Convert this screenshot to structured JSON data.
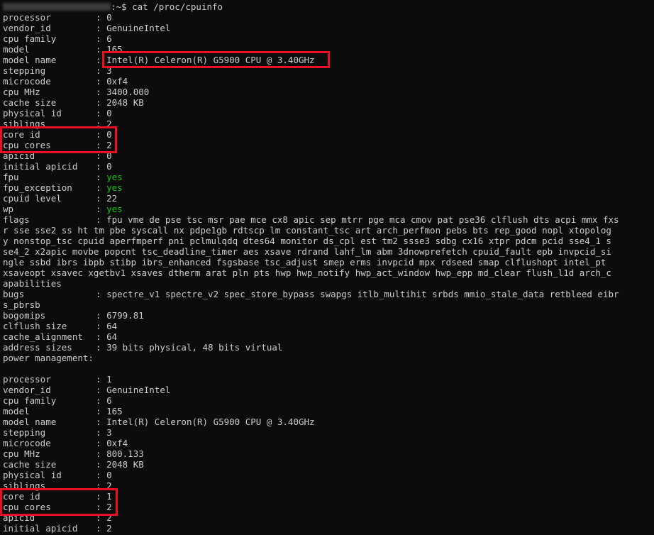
{
  "prompt": {
    "symbol": ":~$ ",
    "command": "cat /proc/cpuinfo"
  },
  "processor0": [
    {
      "key": "processor",
      "value": "0"
    },
    {
      "key": "vendor_id",
      "value": "GenuineIntel"
    },
    {
      "key": "cpu family",
      "value": "6"
    },
    {
      "key": "model",
      "value": "165"
    },
    {
      "key": "model name",
      "value": "Intel(R) Celeron(R) G5900 CPU @ 3.40GHz"
    },
    {
      "key": "stepping",
      "value": "3"
    },
    {
      "key": "microcode",
      "value": "0xf4"
    },
    {
      "key": "cpu MHz",
      "value": "3400.000"
    },
    {
      "key": "cache size",
      "value": "2048 KB"
    },
    {
      "key": "physical id",
      "value": "0"
    },
    {
      "key": "siblings",
      "value": "2"
    },
    {
      "key": "core id",
      "value": "0"
    },
    {
      "key": "cpu cores",
      "value": "2"
    },
    {
      "key": "apicid",
      "value": "0"
    },
    {
      "key": "initial apicid",
      "value": "0"
    },
    {
      "key": "fpu",
      "value": "yes"
    },
    {
      "key": "fpu_exception",
      "value": "yes"
    },
    {
      "key": "cpuid level",
      "value": "22"
    },
    {
      "key": "wp",
      "value": "yes"
    }
  ],
  "flags": {
    "key": "flags",
    "lines": [
      "fpu vme de pse tsc msr pae mce cx8 apic sep mtrr pge mca cmov pat pse36 clflush dts acpi mmx fxs",
      "r sse sse2 ss ht tm pbe syscall nx pdpe1gb rdtscp lm constant_tsc art arch_perfmon pebs bts rep_good nopl xtopolog",
      "y nonstop_tsc cpuid aperfmperf pni pclmulqdq dtes64 monitor ds_cpl est tm2 ssse3 sdbg cx16 xtpr pdcm pcid sse4_1 s",
      "se4_2 x2apic movbe popcnt tsc_deadline_timer aes xsave rdrand lahf_lm abm 3dnowprefetch cpuid_fault epb invpcid_si",
      "ngle ssbd ibrs ibpb stibp ibrs_enhanced fsgsbase tsc_adjust smep erms invpcid mpx rdseed smap clflushopt intel_pt",
      "xsaveopt xsavec xgetbv1 xsaves dtherm arat pln pts hwp hwp_notify hwp_act_window hwp_epp md_clear flush_l1d arch_c",
      "apabilities"
    ]
  },
  "bugs": {
    "key": "bugs",
    "lines": [
      "spectre_v1 spectre_v2 spec_store_bypass swapgs itlb_multihit srbds mmio_stale_data retbleed eibr",
      "s_pbrsb"
    ]
  },
  "tail0": [
    {
      "key": "bogomips",
      "value": "6799.81"
    },
    {
      "key": "clflush size",
      "value": "64"
    },
    {
      "key": "cache_alignment",
      "value": "64"
    },
    {
      "key": "address sizes",
      "value": "39 bits physical, 48 bits virtual"
    },
    {
      "key": "power management",
      "value": ""
    }
  ],
  "processor1": [
    {
      "key": "processor",
      "value": "1"
    },
    {
      "key": "vendor_id",
      "value": "GenuineIntel"
    },
    {
      "key": "cpu family",
      "value": "6"
    },
    {
      "key": "model",
      "value": "165"
    },
    {
      "key": "model name",
      "value": "Intel(R) Celeron(R) G5900 CPU @ 3.40GHz"
    },
    {
      "key": "stepping",
      "value": "3"
    },
    {
      "key": "microcode",
      "value": "0xf4"
    },
    {
      "key": "cpu MHz",
      "value": "800.133"
    },
    {
      "key": "cache size",
      "value": "2048 KB"
    },
    {
      "key": "physical id",
      "value": "0"
    },
    {
      "key": "siblings",
      "value": "2"
    },
    {
      "key": "core id",
      "value": "1"
    },
    {
      "key": "cpu cores",
      "value": "2"
    },
    {
      "key": "apicid",
      "value": "2"
    },
    {
      "key": "initial apicid",
      "value": "2"
    }
  ],
  "colors": {
    "background": "#0c0c0c",
    "text": "#cccccc",
    "yes": "#16c60c",
    "highlight": "#e81123"
  }
}
